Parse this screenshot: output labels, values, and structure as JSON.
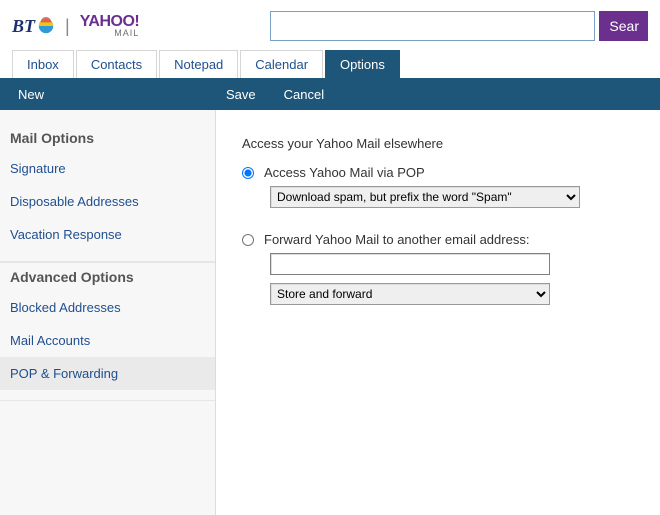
{
  "header": {
    "bt_text": "BT",
    "yahoo_text": "YAHOO!",
    "yahoo_sub": "MAIL",
    "search_value": "",
    "search_btn": "Sear"
  },
  "tabs": {
    "inbox": "Inbox",
    "contacts": "Contacts",
    "notepad": "Notepad",
    "calendar": "Calendar",
    "options": "Options"
  },
  "actions": {
    "new": "New",
    "save": "Save",
    "cancel": "Cancel"
  },
  "sidebar": {
    "group1_header": "Mail Options",
    "group1_items": [
      "Signature",
      "Disposable Addresses",
      "Vacation Response"
    ],
    "group2_header": "Advanced Options",
    "group2_items": [
      "Blocked Addresses",
      "Mail Accounts",
      "POP & Forwarding"
    ]
  },
  "page": {
    "heading": "Access your Yahoo Mail elsewhere",
    "opt1_label": "Access Yahoo Mail via POP",
    "opt1_select_value": "Download spam, but prefix the word \"Spam\"",
    "opt2_label": "Forward Yahoo Mail to another email address:",
    "opt2_input_value": "",
    "opt2_select_value": "Store and forward",
    "selected_radio": "pop"
  }
}
